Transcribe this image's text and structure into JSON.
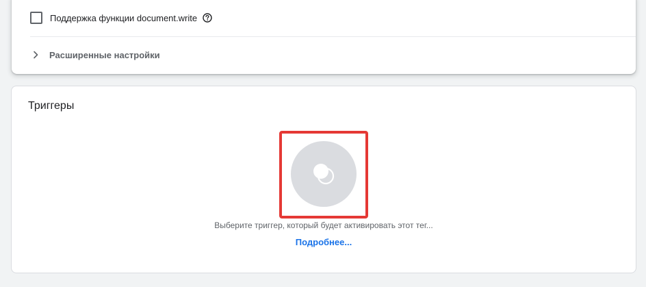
{
  "settings": {
    "docwrite_label": "Поддержка функции document.write",
    "docwrite_checked": false,
    "help_icon": "help-circle-icon",
    "advanced_label": "Расширенные настройки",
    "chevron_icon": "chevron-right-icon"
  },
  "triggers": {
    "title": "Триггеры",
    "icon": "trigger-icon",
    "hint": "Выберите триггер, который будет активировать этот тег...",
    "link": "Подробнее..."
  },
  "colors": {
    "link": "#1a73e8",
    "highlight": "#e53935",
    "trigger_circle": "#dadce0"
  }
}
